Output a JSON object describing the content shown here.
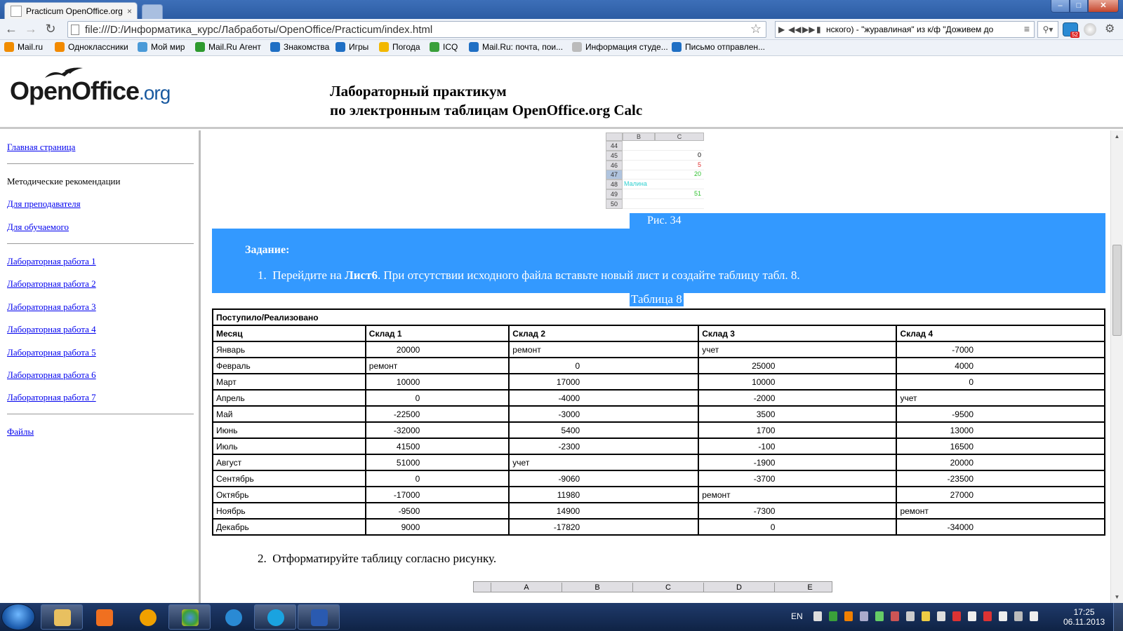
{
  "browser": {
    "tab_title": "Practicum OpenOffice.org",
    "tab_close": "×",
    "url": "file:///D:/Информатика_курс/Лабработы/OpenOffice/Practicum/index.html",
    "media_player": "нского) - \"журавлиная\" из к/ф \"Доживем до",
    "window_buttons": {
      "minimize": "–",
      "maximize": "□",
      "close": "✕"
    }
  },
  "bookmarks": [
    {
      "label": "Mail.ru",
      "color": "#f08c00"
    },
    {
      "label": "Одноклассники",
      "color": "#f28a00"
    },
    {
      "label": "Мой мир",
      "color": "#4a9ad8"
    },
    {
      "label": "Mail.Ru Агент",
      "color": "#2e9a2e"
    },
    {
      "label": "Знакомства",
      "color": "#1f6fc4"
    },
    {
      "label": "Игры",
      "color": "#1f6fc4"
    },
    {
      "label": "Погода",
      "color": "#f2b800"
    },
    {
      "label": "ICQ",
      "color": "#3aa03a"
    },
    {
      "label": "Mail.Ru: почта, пои...",
      "color": "#1f6fc4"
    },
    {
      "label": "Информация студе...",
      "color": "#bbbbbb"
    },
    {
      "label": "Письмо отправлен...",
      "color": "#1f6fc4"
    }
  ],
  "header": {
    "logo_main": "OpenOffice",
    "logo_suffix": ".org",
    "title_line1": "Лабораторный практикум",
    "title_line2": "по электронным таблицам OpenOffice.org Calc"
  },
  "sidebar": {
    "home": "Главная страница",
    "methods": "Методические рекомендации",
    "for_teacher": "Для преподавателя",
    "for_student": "Для обучаемого",
    "labs": [
      "Лабораторная работа 1",
      "Лабораторная работа 2",
      "Лабораторная работа 3",
      "Лабораторная работа 4",
      "Лабораторная работа 5",
      "Лабораторная работа 6",
      "Лабораторная работа 7"
    ],
    "files": "Файлы"
  },
  "figure": {
    "col_b": "B",
    "col_c": "C",
    "rows": [
      {
        "num": "44",
        "b": "",
        "c": "",
        "color": "#000"
      },
      {
        "num": "45",
        "b": "",
        "c": "0",
        "color": "#000"
      },
      {
        "num": "46",
        "b": "",
        "c": "5",
        "color": "#e03030"
      },
      {
        "num": "47",
        "b": "",
        "c": "20",
        "color": "#30c030"
      },
      {
        "num": "48",
        "b": "Малина",
        "c": "",
        "color": "#30d0d0"
      },
      {
        "num": "49",
        "b": "",
        "c": "51",
        "color": "#30c030"
      },
      {
        "num": "50",
        "b": "",
        "c": "",
        "color": "#000"
      }
    ],
    "caption": "Рис. 34"
  },
  "task": {
    "title": "Задание:",
    "item1_num": "1.",
    "item1_pre": "Перейдите на ",
    "item1_bold": "Лист6",
    "item1_post": ". При отсутствии исходного файла вставьте новый лист и создайте таблицу табл. 8."
  },
  "table": {
    "caption": "Таблица 8",
    "title": "Поступило/Реализовано",
    "headers": [
      "Месяц",
      "Склад 1",
      "Склад 2",
      "Склад 3",
      "Склад 4"
    ],
    "rows": [
      [
        "Январь",
        "20000",
        "ремонт",
        "учет",
        "-7000"
      ],
      [
        "Февраль",
        "ремонт",
        "0",
        "25000",
        "4000"
      ],
      [
        "Март",
        "10000",
        "17000",
        "10000",
        "0"
      ],
      [
        "Апрель",
        "0",
        "-4000",
        "-2000",
        "учет"
      ],
      [
        "Май",
        "-22500",
        "-3000",
        "3500",
        "-9500"
      ],
      [
        "Июнь",
        "-32000",
        "5400",
        "1700",
        "13000"
      ],
      [
        "Июль",
        "41500",
        "-2300",
        "-100",
        "16500"
      ],
      [
        "Август",
        "51000",
        "учет",
        "-1900",
        "20000"
      ],
      [
        "Сентябрь",
        "0",
        "-9060",
        "-3700",
        "-23500"
      ],
      [
        "Октябрь",
        "-17000",
        "11980",
        "ремонт",
        "27000"
      ],
      [
        "Ноябрь",
        "-9500",
        "14900",
        "-7300",
        "ремонт"
      ],
      [
        "Декабрь",
        "9000",
        "-17820",
        "0",
        "-34000"
      ]
    ]
  },
  "step2": {
    "num": "2.",
    "text": "Отформатируйте таблицу согласно рисунку."
  },
  "sheet2_cols": [
    "A",
    "B",
    "C",
    "D",
    "E"
  ],
  "taskbar": {
    "lang": "EN",
    "time": "17:25",
    "date": "06.11.2013"
  }
}
